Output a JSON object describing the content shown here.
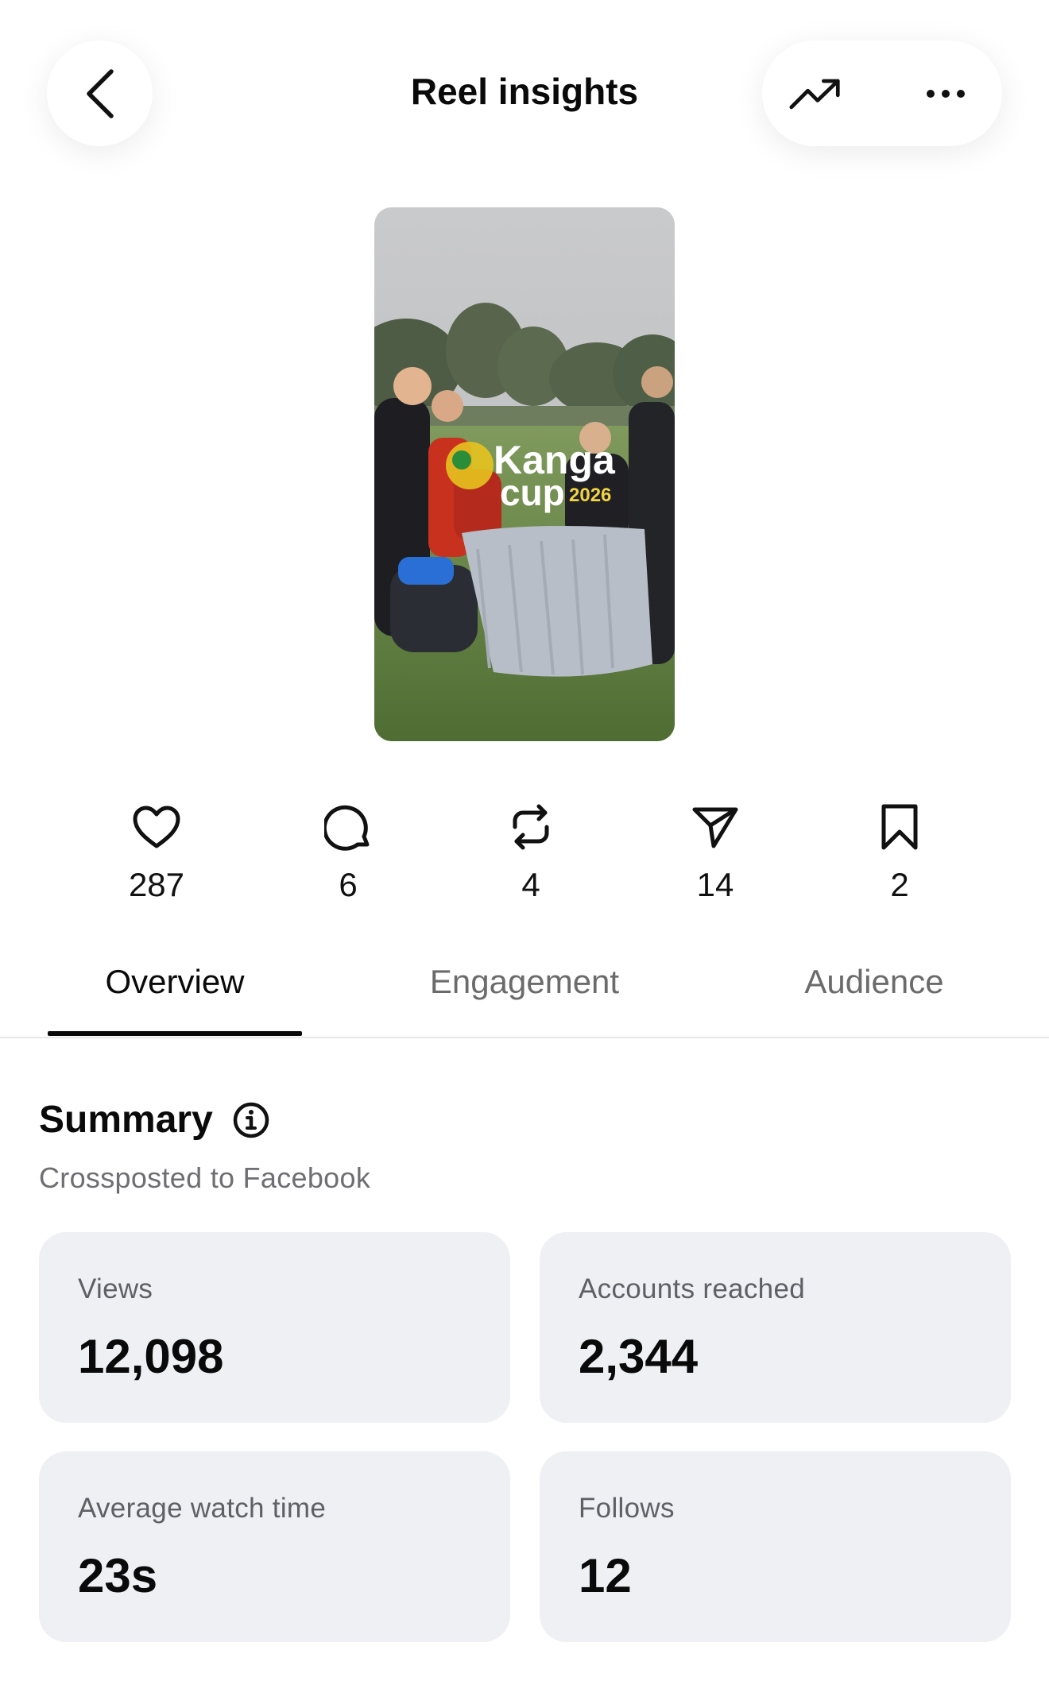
{
  "header": {
    "title": "Reel insights"
  },
  "thumbnail": {
    "overlay_line1": "Kanga",
    "overlay_line2": "cup",
    "overlay_year": "2026"
  },
  "stats": [
    {
      "icon": "heart-icon",
      "value": "287"
    },
    {
      "icon": "comment-icon",
      "value": "6"
    },
    {
      "icon": "repost-icon",
      "value": "4"
    },
    {
      "icon": "share-icon",
      "value": "14"
    },
    {
      "icon": "bookmark-icon",
      "value": "2"
    }
  ],
  "tabs": [
    {
      "label": "Overview",
      "active": true
    },
    {
      "label": "Engagement",
      "active": false
    },
    {
      "label": "Audience",
      "active": false
    }
  ],
  "summary": {
    "title": "Summary",
    "subtitle": "Crossposted to Facebook",
    "cards": [
      {
        "label": "Views",
        "value": "12,098"
      },
      {
        "label": "Accounts reached",
        "value": "2,344"
      },
      {
        "label": "Average watch time",
        "value": "23s"
      },
      {
        "label": "Follows",
        "value": "12"
      }
    ]
  }
}
